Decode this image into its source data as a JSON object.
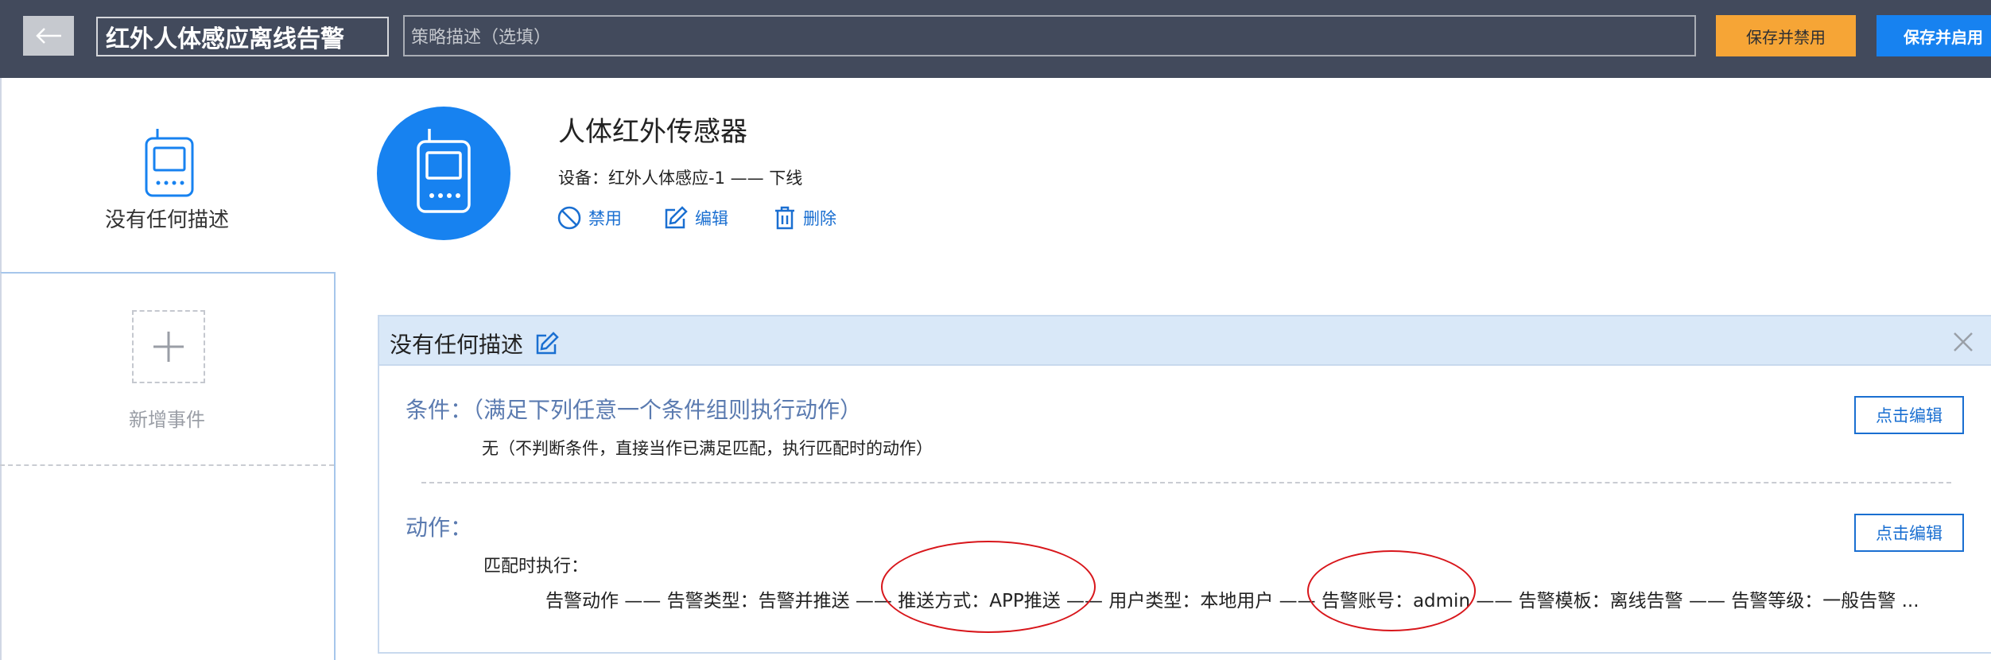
{
  "header": {
    "back_icon": "arrow-left-icon",
    "policy_title": "红外人体感应离线告警",
    "description_placeholder": "策略描述（选填）",
    "save_disable_label": "保存并禁用",
    "save_enable_label": "保存并启用"
  },
  "left_panel": {
    "event_description": "没有任何描述",
    "add_event_label": "新增事件"
  },
  "device": {
    "name": "人体红外传感器",
    "info": "设备：红外人体感应-1 —— 下线",
    "actions": {
      "disable": "禁用",
      "edit": "编辑",
      "delete": "删除"
    }
  },
  "event_card": {
    "title": "没有任何描述",
    "condition": {
      "label": "条件：（满足下列任意一个条件组则执行动作）",
      "text": "无（不判断条件，直接当作已满足匹配，执行匹配时的动作）",
      "edit_label": "点击编辑"
    },
    "action": {
      "label": "动作：",
      "match_label": "匹配时执行：",
      "chain": "告警动作 —— 告警类型：告警并推送 —— 推送方式：APP推送 —— 用户类型：本地用户 —— 告警账号：admin —— 告警模板：离线告警 —— 告警等级：一般告警 ...",
      "edit_label": "点击编辑"
    }
  },
  "colors": {
    "topbar": "#424a5c",
    "primary_blue": "#1782f0",
    "orange": "#f6a536",
    "annotation_red": "#d8161b"
  }
}
